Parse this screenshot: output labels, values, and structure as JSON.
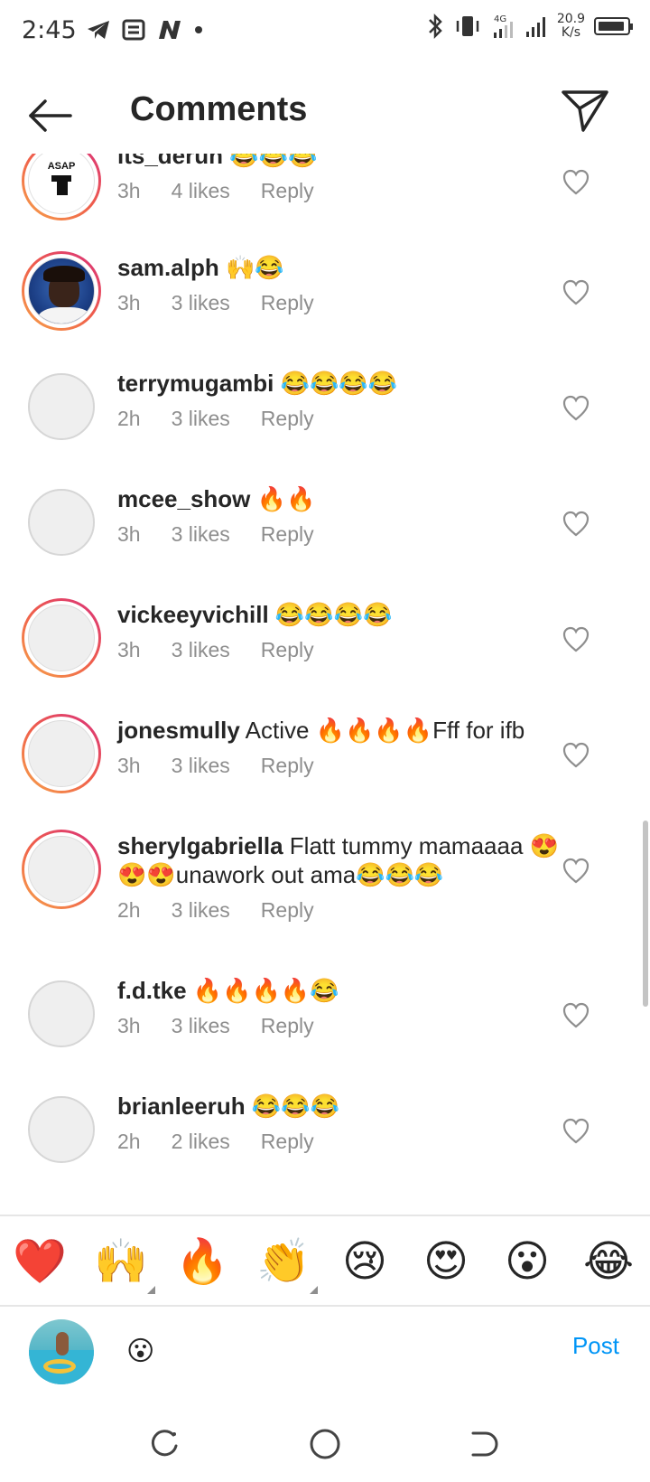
{
  "status_bar": {
    "time": "2:45",
    "net_speed_value": "20.9",
    "net_speed_unit": "K/s",
    "network_type": "4G"
  },
  "header": {
    "title": "Comments"
  },
  "comments": [
    {
      "username": "its_derun",
      "text": "😂😂😂",
      "time": "3h",
      "likes": "4 likes",
      "reply": "Reply",
      "avatar": "asap"
    },
    {
      "username": "sam.alph",
      "text": "🙌😂",
      "time": "3h",
      "likes": "3 likes",
      "reply": "Reply",
      "avatar": "photo"
    },
    {
      "username": "terrymugambi",
      "text": "😂😂😂😂",
      "time": "2h",
      "likes": "3 likes",
      "reply": "Reply",
      "avatar": "blank"
    },
    {
      "username": "mcee_show",
      "text": "🔥🔥",
      "time": "3h",
      "likes": "3 likes",
      "reply": "Reply",
      "avatar": "blank"
    },
    {
      "username": "vickeeyvichill",
      "text": "😂😂😂😂",
      "time": "3h",
      "likes": "3 likes",
      "reply": "Reply",
      "avatar": "blank-ring"
    },
    {
      "username": "jonesmully",
      "text": "Active 🔥🔥🔥🔥Fff for ifb",
      "time": "3h",
      "likes": "3 likes",
      "reply": "Reply",
      "avatar": "blank-ring"
    },
    {
      "username": "sherylgabriella",
      "text": "Flatt tummy mamaaaa 😍😍😍unawork out ama😂😂😂",
      "time": "2h",
      "likes": "3 likes",
      "reply": "Reply",
      "avatar": "blank-ring"
    },
    {
      "username": "f.d.tke",
      "text": "🔥🔥🔥🔥😂",
      "time": "3h",
      "likes": "3 likes",
      "reply": "Reply",
      "avatar": "blank"
    },
    {
      "username": "brianleeruh",
      "text": "😂😂😂",
      "time": "2h",
      "likes": "2 likes",
      "reply": "Reply",
      "avatar": "blank"
    }
  ],
  "emoji_bar": [
    "❤️",
    "🙌",
    "🔥",
    "👏",
    "😢",
    "😍",
    "😮",
    "😂"
  ],
  "compose": {
    "input_value": "😮",
    "post_label": "Post"
  },
  "colors": {
    "accent": "#0095f6",
    "ring_start": "#f7a34a",
    "ring_end": "#d9307b",
    "secondary_text": "#8e8e8e"
  }
}
